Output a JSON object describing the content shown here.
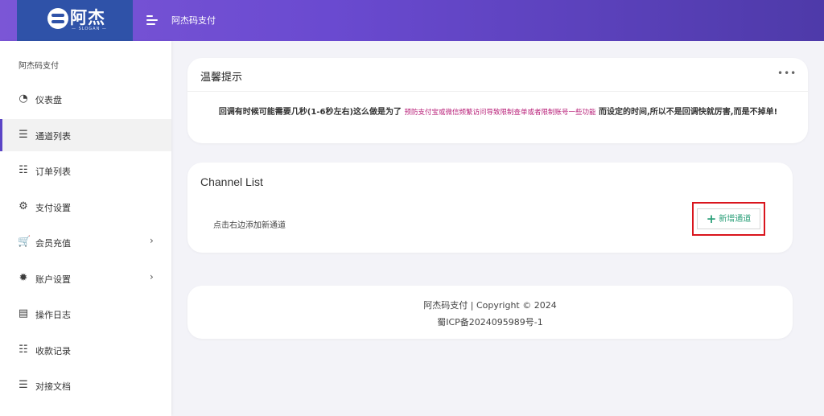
{
  "header": {
    "logo_text": "阿杰",
    "logo_slogan": "— SLOGAN —",
    "title": "阿杰码支付",
    "gradient_start": "#7b56d6",
    "gradient_end": "#4e3aa9",
    "logo_bg": "#2f52a8"
  },
  "sidebar": {
    "heading": "阿杰码支付",
    "items": [
      {
        "label": "仪表盘",
        "icon": "dashboard-icon",
        "glyph": "◔"
      },
      {
        "label": "通道列表",
        "icon": "list-icon",
        "glyph": "☰",
        "active": true
      },
      {
        "label": "订单列表",
        "icon": "list-ul-icon",
        "glyph": "☷"
      },
      {
        "label": "支付设置",
        "icon": "gears-icon",
        "glyph": "⚙"
      },
      {
        "label": "会员充值",
        "icon": "cart-icon",
        "glyph": "🛒",
        "arrow": "›"
      },
      {
        "label": "账户设置",
        "icon": "gear-icon",
        "glyph": "✹",
        "arrow": "›"
      },
      {
        "label": "操作日志",
        "icon": "log-icon",
        "glyph": "▤"
      },
      {
        "label": "收款记录",
        "icon": "records-icon",
        "glyph": "☷"
      },
      {
        "label": "对接文档",
        "icon": "doc-icon",
        "glyph": "☰"
      }
    ]
  },
  "notice": {
    "title": "温馨提示",
    "more": "•••",
    "text_before": "回调有时候可能需要几秒(1-6秒左右)这么做是为了 ",
    "text_highlight": "预防支付宝或微信频繁访问导致限制查单或者限制账号一些功能",
    "text_after": " 而设定的时间,所以不是回调快就厉害,而是不掉单!",
    "highlight_color": "#b81f78"
  },
  "channel": {
    "title": "Channel List",
    "hint": "点击右边添加新通道",
    "add_label": "新增通道",
    "add_plus": "+",
    "add_color": "#2ca07a",
    "highlight_border": "#d9151d"
  },
  "footer": {
    "line1": "阿杰码支付  |  Copyright © 2024",
    "line2": "蜀ICP备2024095989号-1"
  }
}
